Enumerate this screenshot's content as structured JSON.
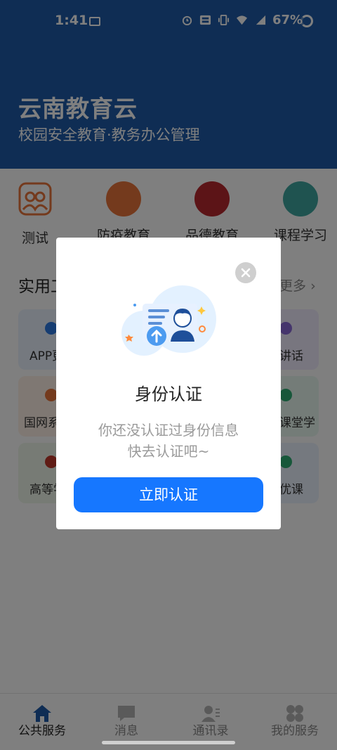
{
  "status_bar": {
    "time": "1:41",
    "battery": "67%",
    "icons": [
      "image-icon",
      "alarm-icon",
      "volte-icon",
      "vibrate-icon",
      "wifi-icon",
      "4g-signal-icon",
      "battery-ring-icon"
    ]
  },
  "header": {
    "title": "云南教育云",
    "subtitle": "校园安全教育·教务办公管理",
    "color": "#1f5ba8"
  },
  "categories": [
    {
      "label": "测试"
    },
    {
      "label": "防疫教育"
    },
    {
      "label": "品德教育"
    },
    {
      "label": "课程学习"
    }
  ],
  "section": {
    "title": "实用工具",
    "more": "更多"
  },
  "tiles": [
    {
      "label": "APP更"
    },
    {
      "label": "讲话"
    },
    {
      "label": "国网系"
    },
    {
      "label": "课堂学"
    },
    {
      "label": "高等学"
    },
    {
      "label": "优课"
    }
  ],
  "tabbar": [
    {
      "label": "公共服务",
      "icon": "home-icon",
      "active": true
    },
    {
      "label": "消息",
      "icon": "message-icon",
      "active": false
    },
    {
      "label": "通讯录",
      "icon": "contacts-icon",
      "active": false
    },
    {
      "label": "我的服务",
      "icon": "grid-icon",
      "active": false
    }
  ],
  "dialog": {
    "title": "身份认证",
    "message_line1": "你还没认证过身份信息",
    "message_line2": "快去认证吧~",
    "button": "立即认证",
    "accent": "#1677ff"
  }
}
